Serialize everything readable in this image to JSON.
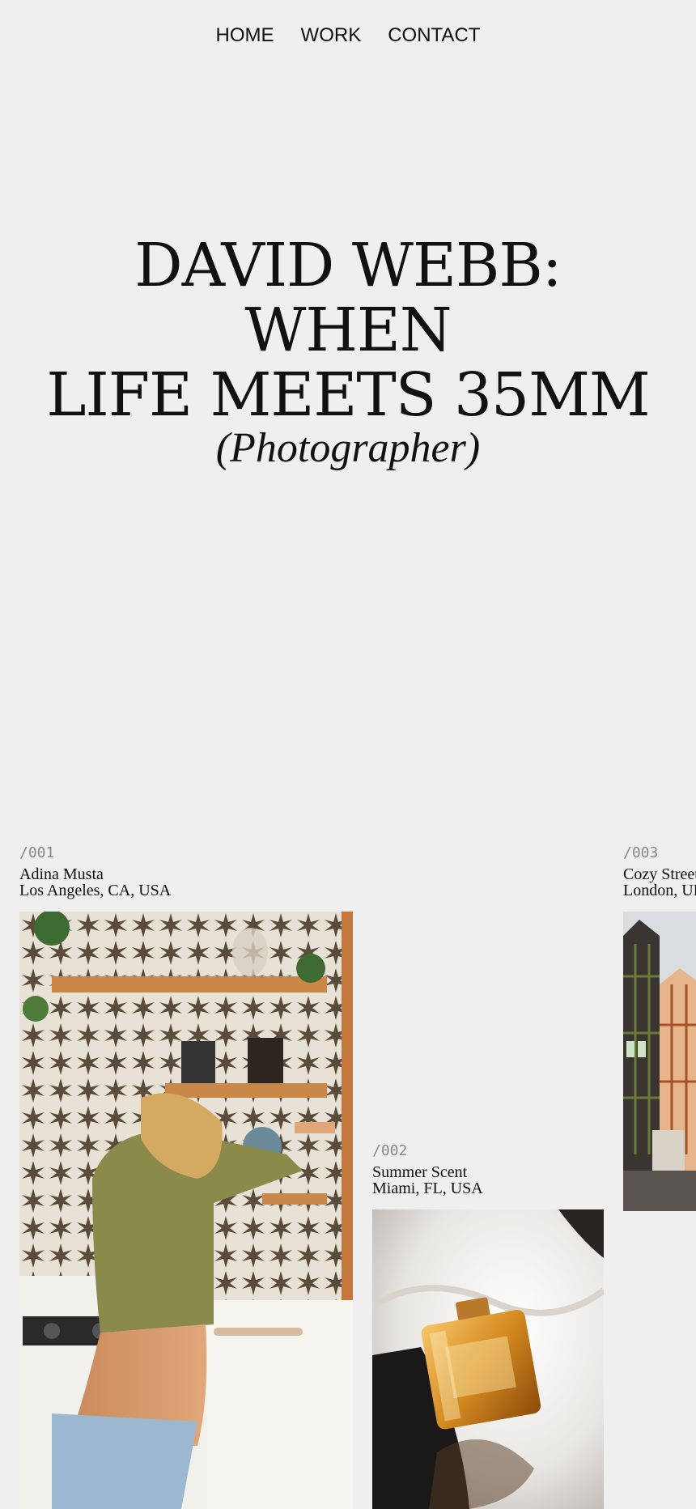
{
  "nav": {
    "items": [
      "HOME",
      "WORK",
      "CONTACT"
    ]
  },
  "hero": {
    "line1": "DAVID WEBB:",
    "line2": "WHEN",
    "line3": "LIFE MEETS 35MM",
    "subtitle": "(Photographer)"
  },
  "works": [
    {
      "number": "/001",
      "title": "Adina Musta",
      "location": "Los Angeles, CA, USA"
    },
    {
      "number": "/002",
      "title": "Summer Scent",
      "location": "Miami, FL, USA"
    },
    {
      "number": "/003",
      "title": "Cozy Street",
      "location": "London, UK"
    }
  ]
}
